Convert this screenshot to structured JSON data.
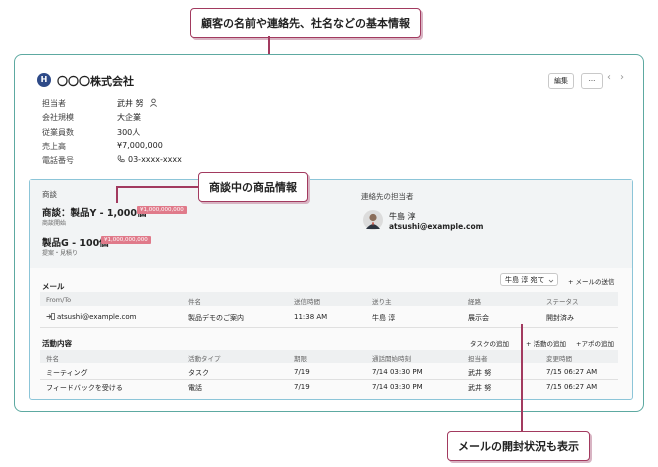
{
  "callouts": {
    "basic_info": "顧客の名前や連絡先、社名などの基本情報",
    "deal_info": "商談中の商品情報",
    "mail_status": "メールの開封状況も表示"
  },
  "company": {
    "logo_text": "H",
    "name": "〇〇〇株式会社",
    "edit_label": "編集",
    "more_label": "···",
    "prev_icon": "‹",
    "next_icon": "›"
  },
  "info": [
    {
      "label": "担当者",
      "value": "武井 努"
    },
    {
      "label": "会社規模",
      "value": "大企業"
    },
    {
      "label": "従業員数",
      "value": "300人"
    },
    {
      "label": "売上高",
      "value": "¥7,000,000"
    },
    {
      "label": "電話番号",
      "value": "03-xxxx-xxxx"
    }
  ],
  "deals": {
    "label": "商談",
    "items": [
      {
        "title": "商談：製品Y - 1,000個",
        "amount": "¥1,000,000,000",
        "stage": "商談開始"
      },
      {
        "title": "製品G - 100個",
        "amount": "¥1,000,000,000",
        "stage": "提案・見積り"
      }
    ]
  },
  "contact": {
    "label": "連絡先の担当者",
    "name": "牛島 淳",
    "email": "atsushi@example.com"
  },
  "mail": {
    "title": "メール",
    "filter": "牛島 淳 宛て",
    "add_link": "+ メールの送信",
    "headers": [
      "From/To",
      "件名",
      "送信時間",
      "送り主",
      "経路",
      "ステータス"
    ],
    "rows": [
      [
        "atsushi@example.com",
        "製品デモのご案内",
        "11:38 AM",
        "牛島 淳",
        "展示会",
        "開封済み"
      ]
    ]
  },
  "activity": {
    "title": "活動内容",
    "links": [
      "タスクの追加",
      "+ 活動の追加",
      "+アポの追加"
    ],
    "headers": [
      "件名",
      "活動タイプ",
      "期限",
      "通話開始時刻",
      "担当者",
      "変更時間"
    ],
    "rows": [
      [
        "ミーティング",
        "タスク",
        "7/19",
        "7/14 03:30 PM",
        "武井 努",
        "7/15 06:27 AM"
      ],
      [
        "フィードバックを受ける",
        "電話",
        "7/19",
        "7/14 03:30 PM",
        "武井 努",
        "7/15 06:27 AM"
      ]
    ]
  }
}
